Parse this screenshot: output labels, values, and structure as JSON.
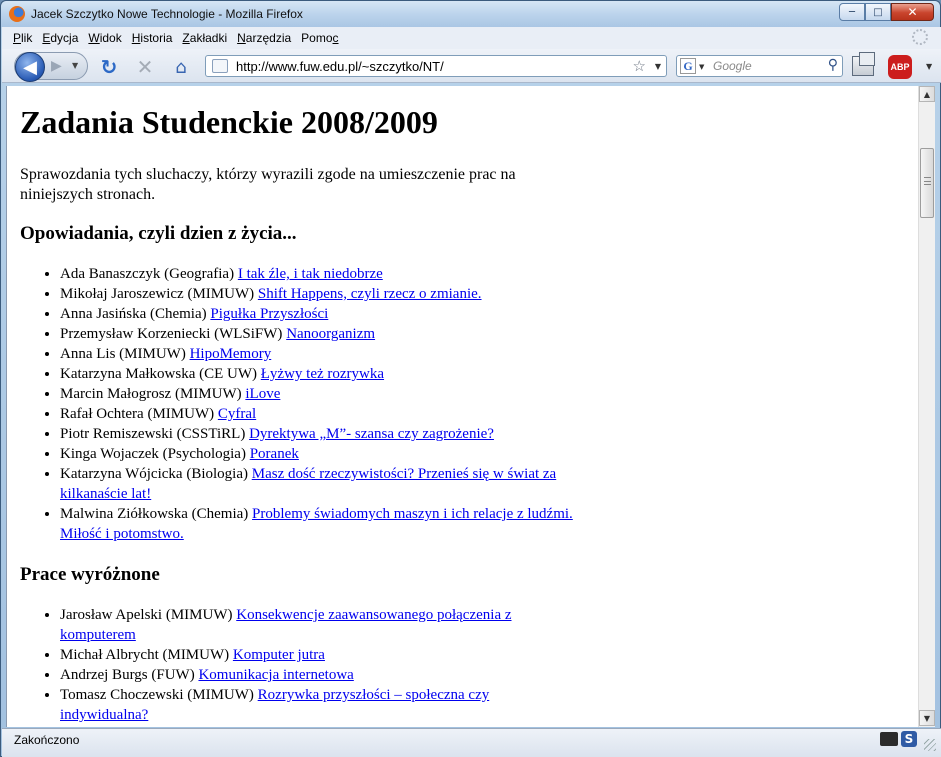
{
  "window": {
    "title": "Jacek Szczytko Nowe Technologie - Mozilla Firefox",
    "buttons": {
      "minimize": "─",
      "maximize": "□",
      "close": "✕"
    }
  },
  "menu": [
    {
      "pre": "",
      "key": "P",
      "post": "lik"
    },
    {
      "pre": "",
      "key": "E",
      "post": "dycja"
    },
    {
      "pre": "",
      "key": "W",
      "post": "idok"
    },
    {
      "pre": "",
      "key": "H",
      "post": "istoria"
    },
    {
      "pre": "",
      "key": "Z",
      "post": "akładki"
    },
    {
      "pre": "",
      "key": "N",
      "post": "arzędzia"
    },
    {
      "pre": "Pomo",
      "key": "c",
      "post": ""
    }
  ],
  "nav": {
    "url": "http://www.fuw.edu.pl/~szczytko/NT/",
    "search_placeholder": "Google",
    "abp_label": "ABP"
  },
  "page": {
    "heading": "Zadania Studenckie 2008/2009",
    "intro": "Sprawozdania tych sluchaczy, którzy wyrazili zgode na umieszczenie prac na niniejszych stronach.",
    "sections": [
      {
        "title": "Opowiadania, czyli dzien z życia...",
        "items": [
          {
            "author": "Ada Banaszczyk (Geografia)",
            "link": "I tak źle, i tak niedobrze"
          },
          {
            "author": "Mikołaj Jaroszewicz (MIMUW)",
            "link": "Shift Happens, czyli rzecz o zmianie."
          },
          {
            "author": "Anna Jasińska (Chemia)",
            "link": "Pigułka Przyszłości"
          },
          {
            "author": "Przemysław Korzeniecki (WLSiFW)",
            "link": "Nanoorganizm"
          },
          {
            "author": "Anna Lis (MIMUW)",
            "link": "HipoMemory"
          },
          {
            "author": "Katarzyna Małkowska (CE UW)",
            "link": "Łyżwy też rozrywka"
          },
          {
            "author": "Marcin Małogrosz (MIMUW)",
            "link": "iLove"
          },
          {
            "author": "Rafał Ochtera (MIMUW)",
            "link": "Cyfral"
          },
          {
            "author": "Piotr Remiszewski (CSSTiRL)",
            "link": "Dyrektywa „M”- szansa czy zagrożenie?"
          },
          {
            "author": "Kinga Wojaczek (Psychologia)",
            "link": "Poranek"
          },
          {
            "author": "Katarzyna Wójcicka (Biologia)",
            "link": "Masz dość rzeczywistości? Przenieś się w świat za kilkanaście lat!"
          },
          {
            "author": "Malwina Ziółkowska (Chemia)",
            "link": "Problemy świadomych maszyn i ich relacje z ludźmi. Miłość i potomstwo."
          }
        ]
      },
      {
        "title": "Prace wyróżnone",
        "items": [
          {
            "author": "Jarosław Apelski (MIMUW)",
            "link": "Konsekwencje zaawansowanego połączenia z komputerem"
          },
          {
            "author": "Michał Albrycht (MIMUW)",
            "link": "Komputer jutra"
          },
          {
            "author": "Andrzej Burgs (FUW)",
            "link": "Komunikacja internetowa"
          },
          {
            "author": "Tomasz Choczewski (MIMUW)",
            "link": "Rozrywka przyszłości – społeczna czy indywidualna?"
          }
        ]
      }
    ]
  },
  "status": {
    "text": "Zakończono"
  },
  "icons": {
    "back": "◀",
    "forward": "▶",
    "reload": "↻",
    "stop": "✕",
    "home": "⌂",
    "star": "☆",
    "search": "⚲",
    "dropdown": "▼",
    "scroll_up": "▲",
    "scroll_down": "▼"
  }
}
